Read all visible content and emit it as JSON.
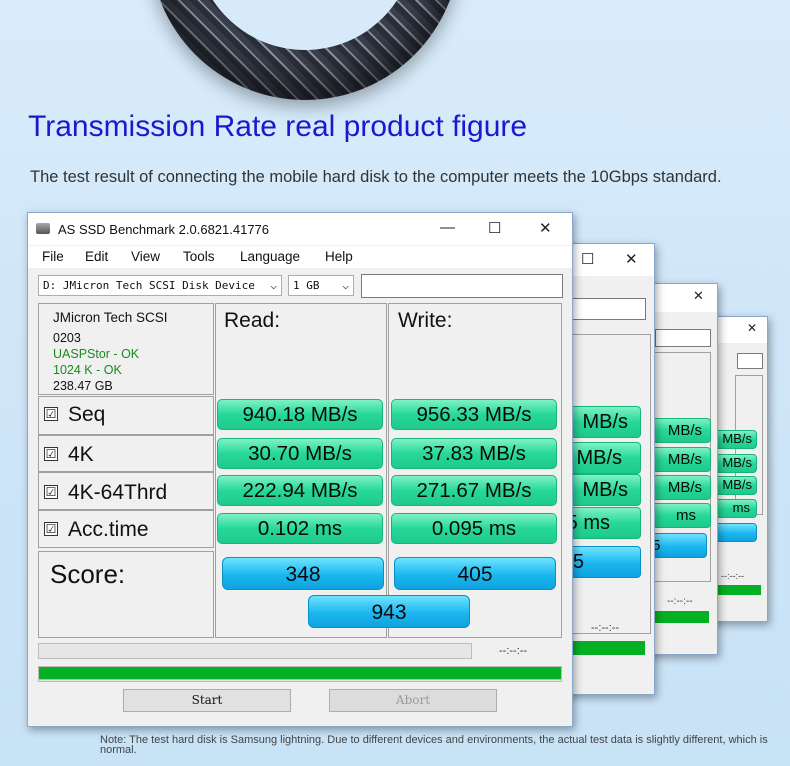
{
  "heading": "Transmission Rate real product figure",
  "subheading": "The test result of connecting the mobile hard disk to the computer meets the 10Gbps standard.",
  "note": "Note: The test hard disk is Samsung lightning. Due to different devices and environments, the actual test data is slightly different, which is normal.",
  "window": {
    "title": "AS SSD Benchmark 2.0.6821.41776",
    "minimize": "—",
    "maximize": "☐",
    "close": "✕",
    "menu": [
      "File",
      "Edit",
      "View",
      "Tools",
      "Language",
      "Help"
    ],
    "drive_select": "D: JMicron Tech SCSI Disk Device",
    "size_select": "1 GB",
    "device_info": {
      "name": "JMicron Tech SCSI",
      "firmware": "0203",
      "driver": "UASPStor - OK",
      "alignment": "1024 K - OK",
      "capacity": "238.47 GB"
    },
    "read_header": "Read:",
    "write_header": "Write:",
    "checkmark": "☑",
    "rows": [
      {
        "label": "Seq",
        "read": "940.18 MB/s",
        "write": "956.33 MB/s"
      },
      {
        "label": "4K",
        "read": "30.70 MB/s",
        "write": "37.83 MB/s"
      },
      {
        "label": "4K-64Thrd",
        "read": "222.94 MB/s",
        "write": "271.67 MB/s"
      },
      {
        "label": "Acc.time",
        "read": "0.102 ms",
        "write": "0.095 ms"
      }
    ],
    "score_label": "Score:",
    "score_read": "348",
    "score_write": "405",
    "score_total": "943",
    "timer": "--:--:--",
    "progress": 1.0,
    "start_label": "Start",
    "abort_label": "Abort"
  },
  "bg_window_2": {
    "values": [
      "MB/s",
      "MB/s",
      "MB/s",
      "5 ms",
      "5"
    ],
    "timer": "--:--:--"
  },
  "bg_window_3": {
    "values": [
      "MB/s",
      "MB/s",
      "MB/s",
      "ms",
      "5"
    ],
    "timer": "--:--:--"
  },
  "bg_window_4": {
    "values": [
      "MB/s",
      "MB/s",
      "MB/s",
      "ms"
    ],
    "timer": "--:--:--"
  },
  "colors": {
    "headline": "#1a1acc",
    "result_green": "#27d89a",
    "score_blue": "#1bb7ef",
    "progress_green": "#06b025"
  }
}
